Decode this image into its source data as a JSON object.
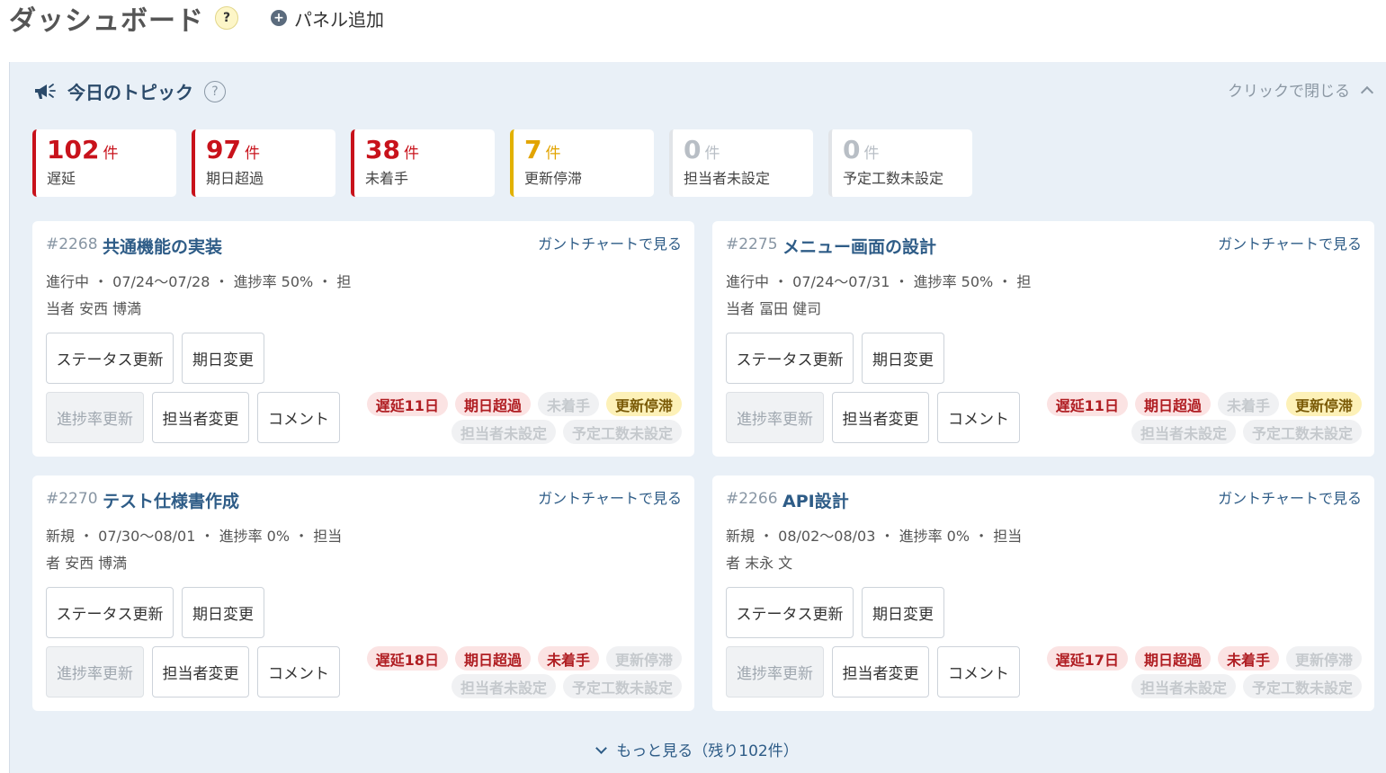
{
  "header": {
    "title": "ダッシュボード",
    "help": "?",
    "add_panel": "パネル追加"
  },
  "panel": {
    "title": "今日のトピック",
    "help": "?",
    "close_label": "クリックで閉じる",
    "stats": [
      {
        "num": "102",
        "unit": "件",
        "label": "遅延",
        "color": "#c8121b",
        "bar": "#c8121b"
      },
      {
        "num": "97",
        "unit": "件",
        "label": "期日超過",
        "color": "#c8121b",
        "bar": "#c8121b"
      },
      {
        "num": "38",
        "unit": "件",
        "label": "未着手",
        "color": "#c8121b",
        "bar": "#c8121b"
      },
      {
        "num": "7",
        "unit": "件",
        "label": "更新停滞",
        "color": "#e2a400",
        "bar": "#e2b100"
      },
      {
        "num": "0",
        "unit": "件",
        "label": "担当者未設定",
        "color": "#b8bec5",
        "bar": "#e1e4e8"
      },
      {
        "num": "0",
        "unit": "件",
        "label": "予定工数未設定",
        "color": "#b8bec5",
        "bar": "#e1e4e8"
      }
    ],
    "more_label": "もっと見る（残り102件）"
  },
  "cards": [
    {
      "id": "#2268",
      "title": "共通機能の実装",
      "gantt": "ガントチャートで見る",
      "meta": "進行中 ・ 07/24〜07/28 ・ 進捗率 50% ・ 担当者 安西 博満",
      "buttons": [
        "ステータス更新",
        "期日変更",
        "進捗率更新",
        "担当者変更",
        "コメント"
      ],
      "tags": [
        {
          "text": "遅延11日",
          "style": "red"
        },
        {
          "text": "期日超過",
          "style": "red"
        },
        {
          "text": "未着手",
          "style": "gray"
        },
        {
          "text": "更新停滞",
          "style": "yellow"
        },
        {
          "text": "担当者未設定",
          "style": "gray"
        },
        {
          "text": "予定工数未設定",
          "style": "gray"
        }
      ]
    },
    {
      "id": "#2275",
      "title": "メニュー画面の設計",
      "gantt": "ガントチャートで見る",
      "meta": "進行中 ・ 07/24〜07/31 ・ 進捗率 50% ・ 担当者 冨田 健司",
      "buttons": [
        "ステータス更新",
        "期日変更",
        "進捗率更新",
        "担当者変更",
        "コメント"
      ],
      "tags": [
        {
          "text": "遅延11日",
          "style": "red"
        },
        {
          "text": "期日超過",
          "style": "red"
        },
        {
          "text": "未着手",
          "style": "gray"
        },
        {
          "text": "更新停滞",
          "style": "yellow"
        },
        {
          "text": "担当者未設定",
          "style": "gray"
        },
        {
          "text": "予定工数未設定",
          "style": "gray"
        }
      ]
    },
    {
      "id": "#2270",
      "title": "テスト仕様書作成",
      "gantt": "ガントチャートで見る",
      "meta": "新規 ・ 07/30〜08/01 ・ 進捗率 0% ・ 担当者 安西 博満",
      "buttons": [
        "ステータス更新",
        "期日変更",
        "進捗率更新",
        "担当者変更",
        "コメント"
      ],
      "tags": [
        {
          "text": "遅延18日",
          "style": "red"
        },
        {
          "text": "期日超過",
          "style": "red"
        },
        {
          "text": "未着手",
          "style": "red"
        },
        {
          "text": "更新停滞",
          "style": "gray"
        },
        {
          "text": "担当者未設定",
          "style": "gray"
        },
        {
          "text": "予定工数未設定",
          "style": "gray"
        }
      ]
    },
    {
      "id": "#2266",
      "title": "API設計",
      "gantt": "ガントチャートで見る",
      "meta": "新規 ・ 08/02〜08/03 ・ 進捗率 0% ・ 担当者 末永 文",
      "buttons": [
        "ステータス更新",
        "期日変更",
        "進捗率更新",
        "担当者変更",
        "コメント"
      ],
      "tags": [
        {
          "text": "遅延17日",
          "style": "red"
        },
        {
          "text": "期日超過",
          "style": "red"
        },
        {
          "text": "未着手",
          "style": "red"
        },
        {
          "text": "更新停滞",
          "style": "gray"
        },
        {
          "text": "担当者未設定",
          "style": "gray"
        },
        {
          "text": "予定工数未設定",
          "style": "gray"
        }
      ]
    }
  ]
}
